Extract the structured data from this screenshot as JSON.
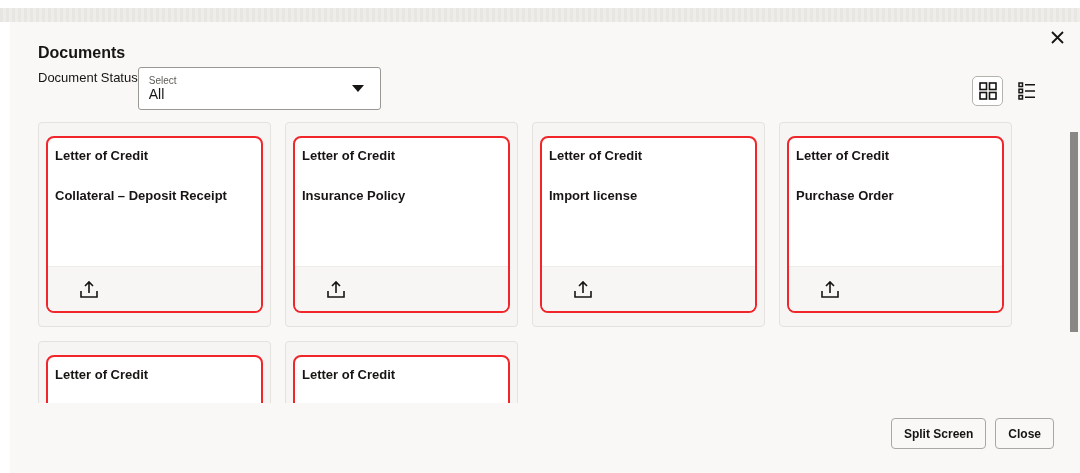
{
  "dialog": {
    "title": "Documents"
  },
  "filter": {
    "label": "Document Status",
    "field_label": "Select",
    "value": "All"
  },
  "view_toggle": [
    {
      "kind": "grid",
      "selected": true
    },
    {
      "kind": "list",
      "selected": false
    }
  ],
  "documents": [
    {
      "category": "Letter of Credit",
      "name": "Collateral – Deposit Receipt"
    },
    {
      "category": "Letter of Credit",
      "name": "Insurance Policy"
    },
    {
      "category": "Letter of Credit",
      "name": "Import license"
    },
    {
      "category": "Letter of Credit",
      "name": "Purchase Order"
    },
    {
      "category": "Letter of Credit"
    },
    {
      "category": "Letter of Credit"
    }
  ],
  "buttons": [
    "Split Screen",
    "Close"
  ]
}
